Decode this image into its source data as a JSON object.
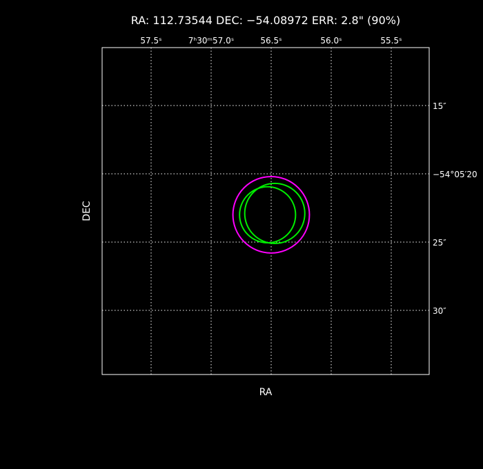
{
  "title": "RA: 112.73544   DEC: −54.08972   ERR: 2.8\" (90%)",
  "colors": {
    "background": "#000000",
    "frame": "#ffffff",
    "grid": "#ffffff",
    "error_circle": "#ff00ff",
    "detections": "#00ee00"
  },
  "chart_data": {
    "type": "scatter",
    "xlabel": "RA",
    "ylabel": "DEC",
    "grid": true,
    "x_ticks": [
      {
        "value": 57.5,
        "label": "57.5ˢ"
      },
      {
        "value": 57.0,
        "label": "7ʰ30ᵐ57.0ˢ"
      },
      {
        "value": 56.5,
        "label": "56.5ˢ"
      },
      {
        "value": 56.0,
        "label": "56.0ˢ"
      },
      {
        "value": 55.5,
        "label": "55.5ˢ"
      }
    ],
    "y_ticks": [
      {
        "value": 15,
        "label": "15″"
      },
      {
        "value": 20,
        "label": "−54°05′20"
      },
      {
        "value": 25,
        "label": "25″"
      },
      {
        "value": 30,
        "label": "30″"
      }
    ],
    "error_circle": {
      "ra_sec": 56.5,
      "dec_arcsec": 23.0,
      "radius_arcsec": 2.8
    },
    "detections": [
      {
        "ra_sec": 56.47,
        "dec_arcsec": 22.9,
        "radius_arcsec": 2.2
      },
      {
        "ra_sec": 56.53,
        "dec_arcsec": 23.0,
        "radius_arcsec": 2.05
      }
    ]
  }
}
